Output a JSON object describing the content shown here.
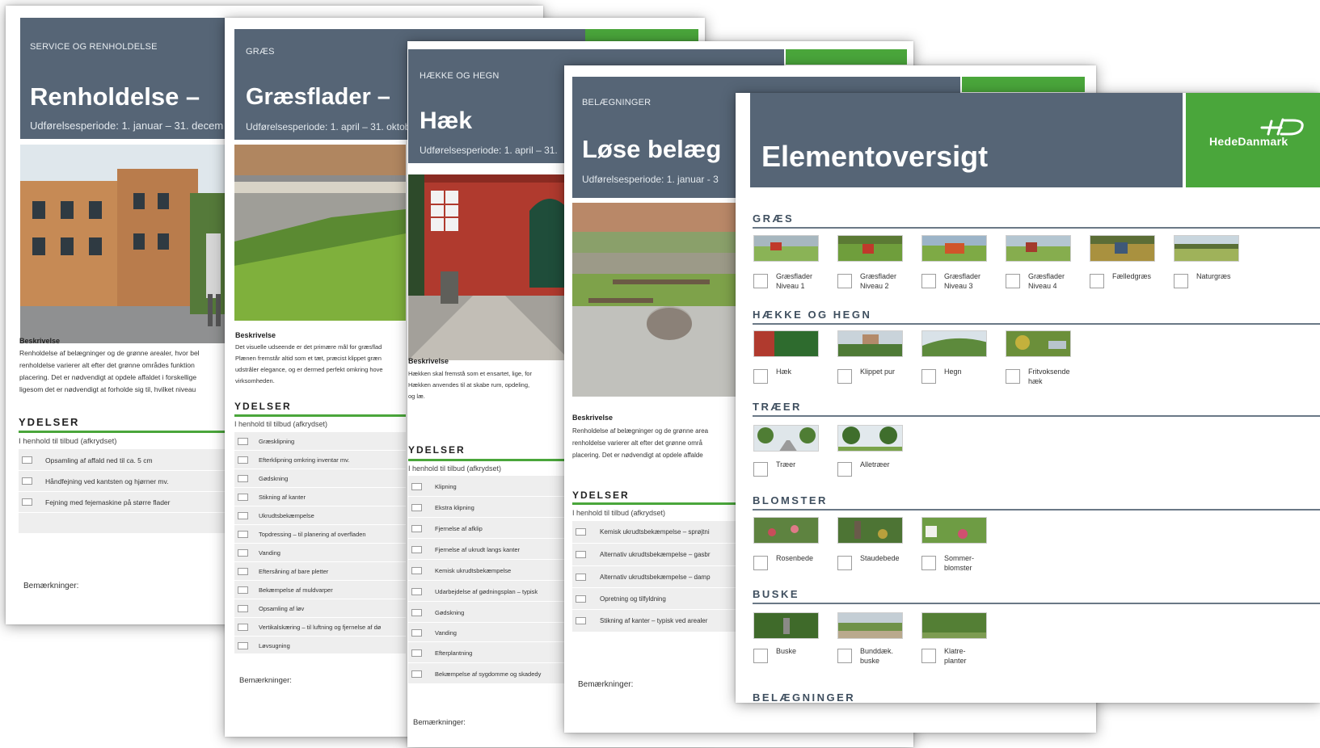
{
  "colors": {
    "header": "#566576",
    "green": "#4aa63b",
    "row_bg": "#eeeeee"
  },
  "page1": {
    "kicker": "SERVICE OG RENHOLDELSE",
    "title": "Renholdelse –",
    "period": "Udførelsesperiode: 1. januar – 31. decem",
    "beskrivelse_heading": "Beskrivelse",
    "beskrivelse_lines": [
      "Renholdelse af belægninger og de grønne arealer, hvor bel",
      "renholdelse varierer alt efter det grønne områdes funktion",
      "placering. Det er nødvendigt at opdele affaldet i forskellige",
      "ligesom det er nødvendigt at forholde sig til, hvilket niveau"
    ],
    "ydelser_heading": "YDELSER",
    "tilbud": "I henhold til tilbud (afkrydset)",
    "rows": [
      "Opsamling af affald ned til ca. 5 cm",
      "Håndfejning ved kantsten og hjørner mv.",
      "Fejning med fejemaskine på større flader"
    ],
    "remark": "Bemærkninger:"
  },
  "page2": {
    "kicker": "GRÆS",
    "title": "Græsflader –",
    "period": "Udførelsesperiode: 1. april – 31. oktob",
    "beskrivelse_heading": "Beskrivelse",
    "beskrivelse_lines": [
      "Det visuelle udseende er det primære mål for græsflad",
      "Plænen fremstår altid som et tæt, præcist klippet græn",
      "udstråler elegance, og er dermed perfekt omkring hove",
      "virksomheden."
    ],
    "ydelser_heading": "YDELSER",
    "tilbud": "I henhold til tilbud (afkrydset)",
    "rows": [
      "Græsklipning",
      "Efterklipning omkring inventar mv.",
      "Gødskning",
      "Stikning af kanter",
      "Ukrudtsbekæmpelse",
      "Topdressing – til planering af overfladen",
      "Vanding",
      "Eftersåning af bare pletter",
      "Bekæmpelse af muldvarper",
      "Opsamling af løv",
      "Vertikalskæring – til luftning og fjernelse af dø",
      "Løvsugning"
    ],
    "remark": "Bemærkninger:"
  },
  "page3": {
    "kicker": "HÆKKE OG HEGN",
    "title": "Hæk",
    "period": "Udførelsesperiode: 1. april – 31.",
    "beskrivelse_heading": "Beskrivelse",
    "beskrivelse_lines": [
      "Hækken skal fremstå som et ensartet, lige, for",
      "Hækken anvendes til at skabe rum, opdeling,",
      "og læ."
    ],
    "ydelser_heading": "YDELSER",
    "tilbud": "I henhold til tilbud (afkrydset)",
    "rows": [
      "Klipning",
      "Ekstra klipning",
      "Fjernelse af afklip",
      "Fjernelse af ukrudt langs kanter",
      "Kemisk ukrudtsbekæmpelse",
      "Udarbejdelse af gødningsplan – typisk",
      "Gødskning",
      "Vanding",
      "Efterplantning",
      "Bekæmpelse af sygdomme og skadedy"
    ],
    "remark": "Bemærkninger:"
  },
  "page4": {
    "kicker": "BELÆGNINGER",
    "title": "Løse belæg",
    "period": "Udførelsesperiode: 1. januar - 3",
    "beskrivelse_heading": "Beskrivelse",
    "beskrivelse_lines": [
      "Renholdelse af belægninger og de grønne area",
      "renholdelse varierer alt efter det grønne områ",
      "placering. Det er nødvendigt at opdele affalde"
    ],
    "ydelser_heading": "YDELSER",
    "tilbud": "I henhold til tilbud (afkrydset)",
    "rows": [
      "Kemisk ukrudtsbekæmpelse – sprøjtni",
      "Alternativ ukrudtsbekæmpelse – gasbr",
      "Alternativ ukrudtsbekæmpelse – damp",
      "Opretning og tilfyldning",
      "Stikning af kanter – typisk ved arealer"
    ],
    "remark": "Bemærkninger:"
  },
  "page5": {
    "title": "Elementoversigt",
    "logo_text": "HedeDanmark",
    "logo_icon": "hede-danmark-logo-icon",
    "sections": [
      {
        "heading": "GRÆS",
        "items": [
          {
            "line1": "Græsflader",
            "line2": "Niveau 1"
          },
          {
            "line1": "Græsflader",
            "line2": "Niveau 2"
          },
          {
            "line1": "Græsflader",
            "line2": "Niveau 3"
          },
          {
            "line1": "Græsflader",
            "line2": "Niveau 4"
          },
          {
            "line1": "Fælledgræs",
            "line2": ""
          },
          {
            "line1": "Naturgræs",
            "line2": ""
          }
        ]
      },
      {
        "heading": "HÆKKE OG HEGN",
        "items": [
          {
            "line1": "Hæk",
            "line2": ""
          },
          {
            "line1": "Klippet pur",
            "line2": ""
          },
          {
            "line1": "Hegn",
            "line2": ""
          },
          {
            "line1": "Fritvoksende",
            "line2": "hæk"
          }
        ]
      },
      {
        "heading": "TRÆER",
        "items": [
          {
            "line1": "Træer",
            "line2": ""
          },
          {
            "line1": "Alletræer",
            "line2": ""
          }
        ]
      },
      {
        "heading": "BLOMSTER",
        "items": [
          {
            "line1": "Rosenbede",
            "line2": ""
          },
          {
            "line1": "Staudebede",
            "line2": ""
          },
          {
            "line1": "Sommer-",
            "line2": "blomster"
          }
        ]
      },
      {
        "heading": "BUSKE",
        "items": [
          {
            "line1": "Buske",
            "line2": ""
          },
          {
            "line1": "Bunddæk.",
            "line2": "buske"
          },
          {
            "line1": "Klatre-",
            "line2": "planter"
          }
        ]
      },
      {
        "heading": "BELÆGNINGER",
        "items": []
      }
    ]
  }
}
